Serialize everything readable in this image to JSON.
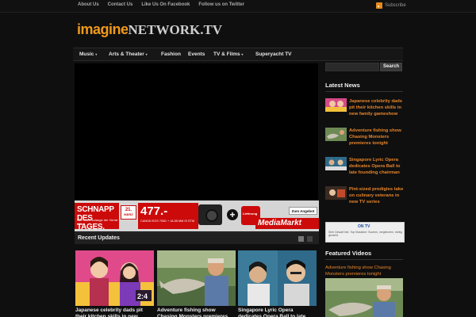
{
  "topbar": {
    "links": [
      "About Us",
      "Contact Us",
      "Like Us On Facebook",
      "Follow us on Twitter"
    ],
    "subscribe": "Subscribe"
  },
  "logo": {
    "part1": "imagine",
    "part2": "NETWORK.TV"
  },
  "nav": [
    {
      "label": "Music",
      "dropdown": true
    },
    {
      "label": "Arts & Theater",
      "dropdown": true
    },
    {
      "label": "Fashion",
      "dropdown": false
    },
    {
      "label": "Events",
      "dropdown": false
    },
    {
      "label": "TV & Films",
      "dropdown": true
    },
    {
      "label": "Superyacht TV",
      "dropdown": false
    }
  ],
  "ad": {
    "headline": "SCHNAPP DES TAGES.",
    "subline": "Nur heute solange der Vorrat reicht.",
    "date_day": "21.",
    "date_month": "MÄRZ",
    "price": "477.-",
    "product": "CANON EOS 700D + 18-55 MM IS STM",
    "badge": "Lieferung",
    "button": "Zum Angebot",
    "brand": "MediaMarkt"
  },
  "recent": {
    "title": "Recent Updates",
    "items": [
      {
        "caption": "Japanese celebrity dads pit their kitchen skills in new"
      },
      {
        "caption": "Adventure fishing show Chasing Monsters premieres"
      },
      {
        "caption": "Singapore Lyric Opera dedicates Opera Ball to late"
      }
    ]
  },
  "sidebar": {
    "search_button": "Search",
    "latest_title": "Latest News",
    "news": [
      {
        "title": "Japanese celebrity dads pit their kitchen skills in new family gameshow"
      },
      {
        "title": "Adventure fishing show Chasing Monsters premieres tonight"
      },
      {
        "title": "Singapore Lyric Opera dedicates Opera Ball to late founding chairman"
      },
      {
        "title": "Pint-sized prodigies take on culinary veterans in new TV series"
      }
    ],
    "ad_title": "ON TV",
    "ad_text": "Sieh Gewalt hier. Top Klassiker: Suchen, vergleichen, richtig genießt.",
    "featured_title": "Featured Videos",
    "featured_link": "Adventure fishing show Chasing Monsters premieres tonight"
  },
  "colors": {
    "accent": "#e8852a",
    "background": "#0f0f0f",
    "ad_red": "#cc0a0a"
  }
}
